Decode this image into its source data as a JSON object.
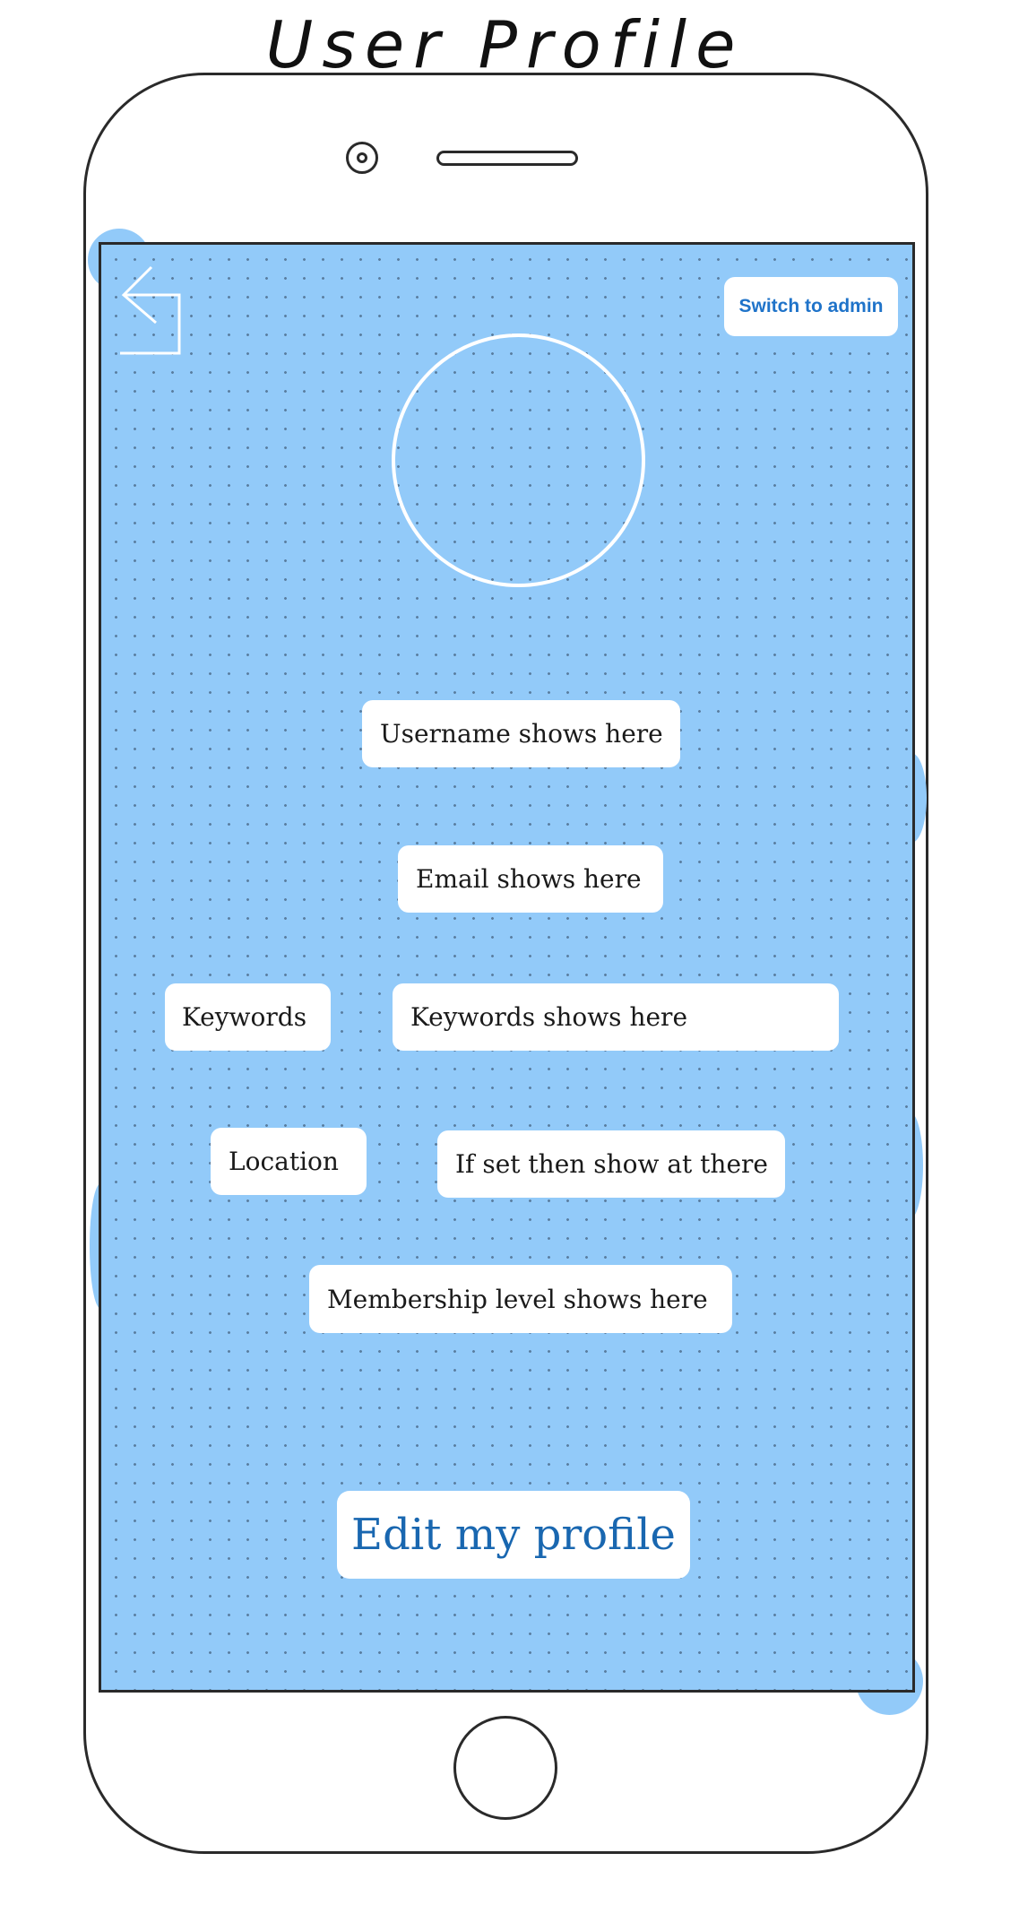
{
  "page_title": "User Profile",
  "header": {
    "switch_admin_label": "Switch to admin"
  },
  "profile": {
    "username": "Username shows here",
    "email": "Email shows here",
    "keywords_label": "Keywords",
    "keywords_value": "Keywords shows here",
    "location_label": "Location",
    "location_value": "If set then show at there",
    "membership": "Membership level shows here"
  },
  "actions": {
    "edit_label": "Edit my profile"
  },
  "colors": {
    "screen_bg": "#92caf9",
    "admin_text": "#1f73c9",
    "edit_text": "#1967b0"
  },
  "icons": {
    "back": "back-arrow-icon",
    "avatar": "avatar-placeholder"
  }
}
